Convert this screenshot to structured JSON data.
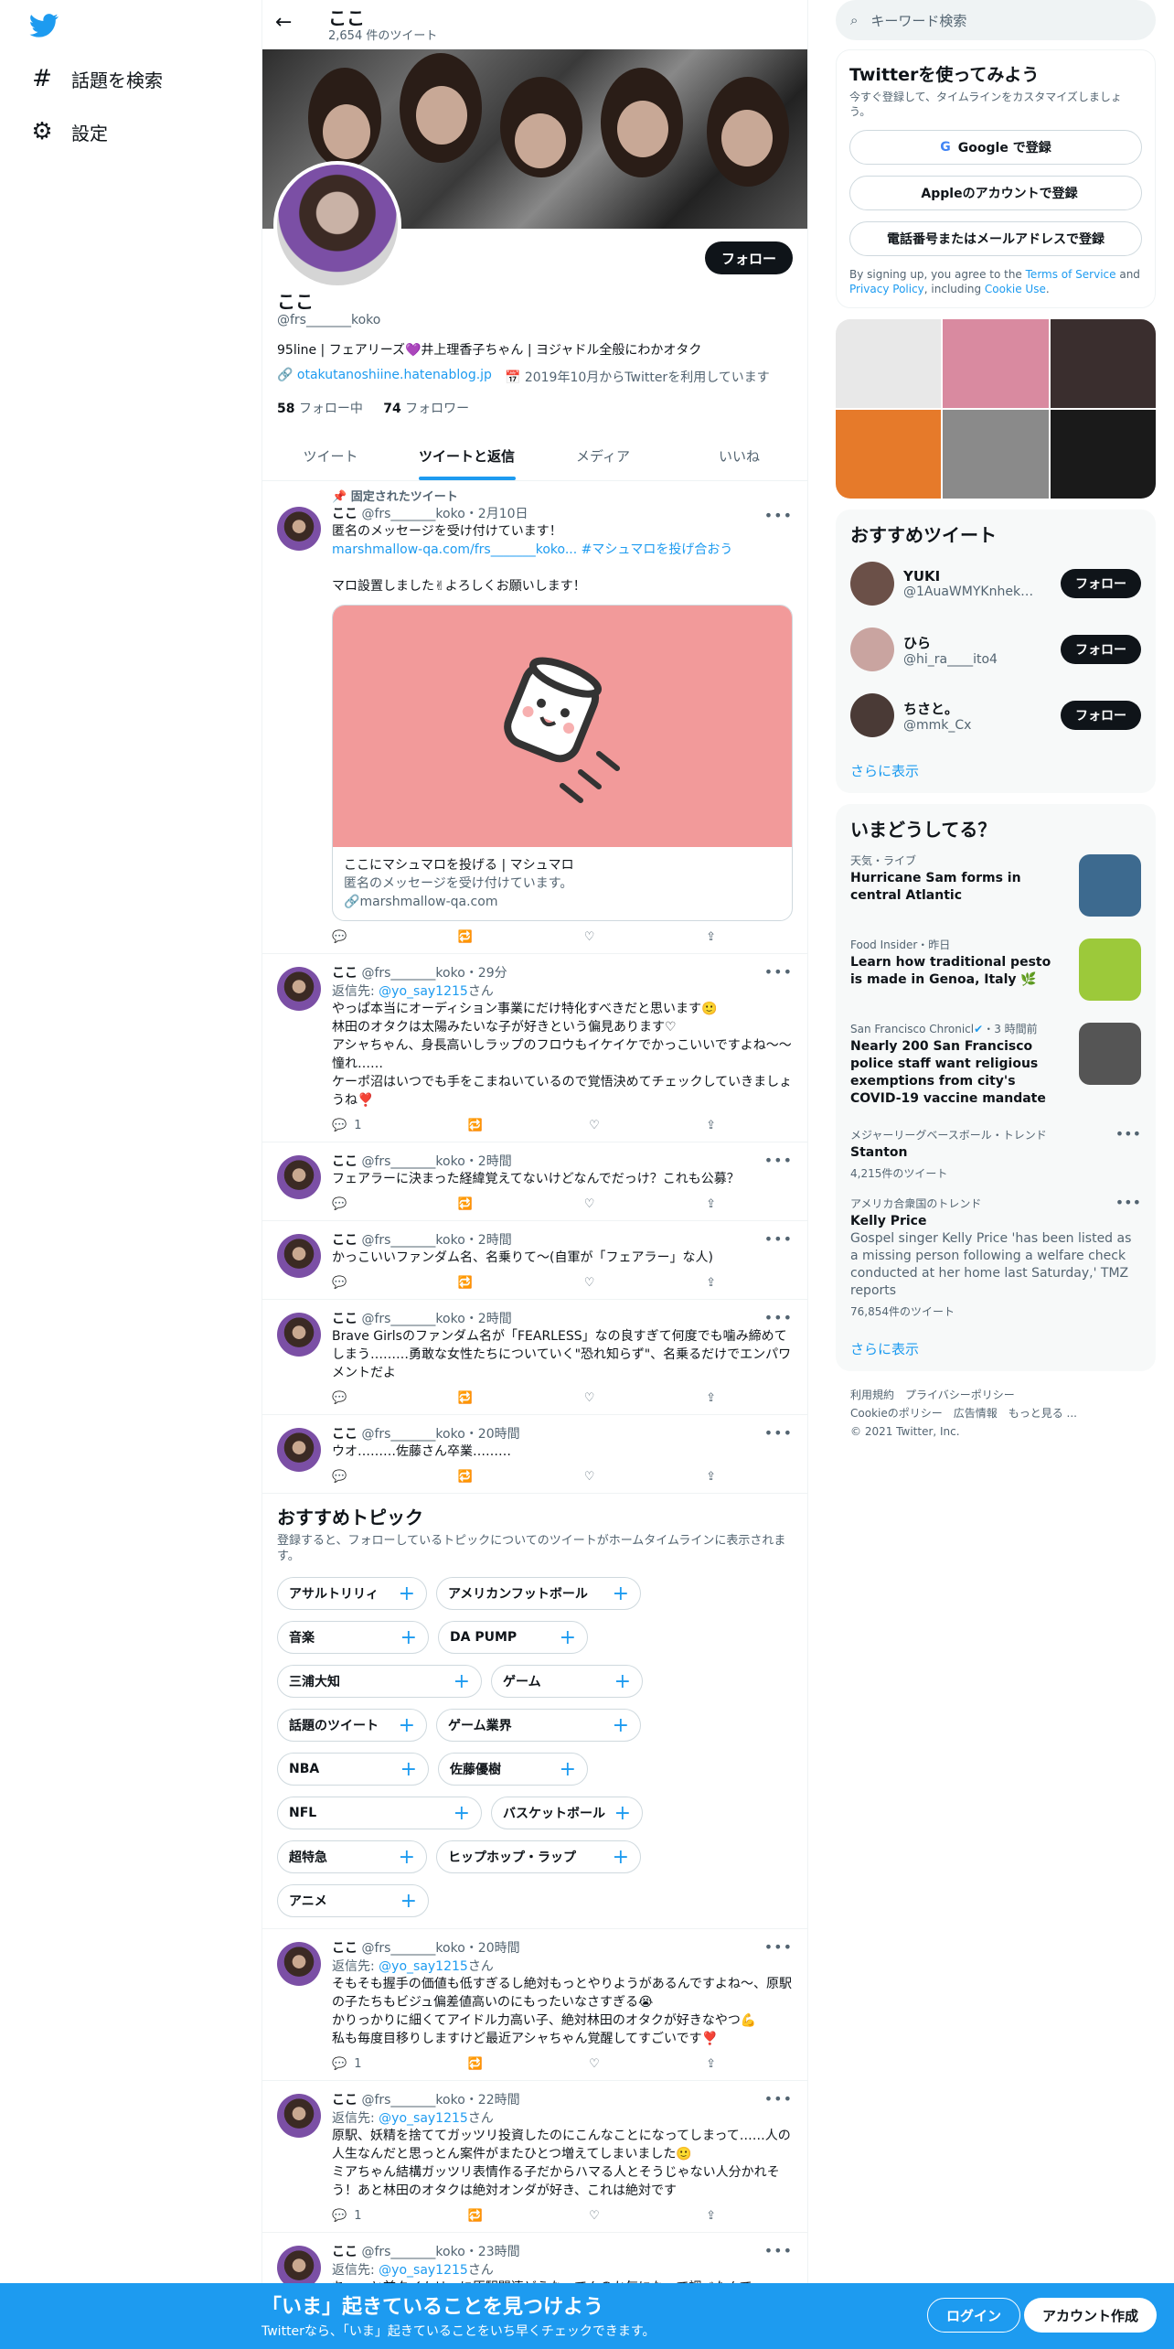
{
  "nav": {
    "explore": "話題を検索",
    "settings": "設定"
  },
  "header": {
    "name": "ここ",
    "count": "2,654 件のツイート"
  },
  "profile": {
    "follow": "フォロー",
    "name": "ここ",
    "handle": "@frs_______koko",
    "bio": "95line | フェアリーズ💜井上理香子ちゃん | ヨジャドル全般にわかオタク",
    "link": "otakutanoshiine.hatenablog.jp",
    "joined": "2019年10月からTwitterを利用しています",
    "following_count": "58",
    "following_label": "フォロー中",
    "followers_count": "74",
    "followers_label": "フォロワー"
  },
  "tabs": [
    "ツイート",
    "ツイートと返信",
    "メディア",
    "いいね"
  ],
  "pinned_label": "固定されたツイート",
  "tweets": [
    {
      "name": "ここ",
      "handle": "@frs_______koko",
      "time": "・2月10日",
      "text": "匿名のメッセージを受け付けています！",
      "link": "marshmallow-qa.com/frs_______koko...",
      "hashtag": "#マシュマロを投げ合おう",
      "text2": "マロ設置しました✌よろしくお願いします！",
      "card_title": "ここにマシュマロを投げる | マシュマロ",
      "card_sub": "匿名のメッセージを受け付けています。",
      "card_link": "marshmallow-qa.com"
    },
    {
      "name": "ここ",
      "handle": "@frs_______koko",
      "time": "・29分",
      "reply_prefix": "返信先: ",
      "reply_to": "@yo_say1215",
      "reply_suffix": "さん",
      "text": "やっぱ本当にオーディション事業にだけ特化すべきだと思います🙂\n林田のオタクは太陽みたいな子が好きという偏見あります♡\nアシャちゃん、身長高いしラップのフロウもイケイケでかっこいいですよね〜〜憧れ……\nケーポ沼はいつでも手をこまねいているので覚悟決めてチェックしていきましょうね❣️",
      "reply_count": "1"
    },
    {
      "name": "ここ",
      "handle": "@frs_______koko",
      "time": "・2時間",
      "text": "フェアラーに決まった経緯覚えてないけどなんでだっけ？これも公募？"
    },
    {
      "name": "ここ",
      "handle": "@frs_______koko",
      "time": "・2時間",
      "text": "かっこいいファンダム名、名乗りて〜(自軍が「フェアラー」な人)"
    },
    {
      "name": "ここ",
      "handle": "@frs_______koko",
      "time": "・2時間",
      "text": "Brave Girlsのファンダム名が「FEARLESS」なの良すぎて何度でも噛み締めてしまう………勇敢な女性たちについていく\"恐れ知らず\"、名乗るだけでエンパワメントだよ"
    },
    {
      "name": "ここ",
      "handle": "@frs_______koko",
      "time": "・20時間",
      "text": "ウオ………佐藤さん卒業………"
    },
    {
      "name": "ここ",
      "handle": "@frs_______koko",
      "time": "・20時間",
      "reply_prefix": "返信先: ",
      "reply_to": "@yo_say1215",
      "reply_suffix": "さん",
      "text": "そもそも握手の価値も低すぎるし絶対もっとやりようがあるんですよね〜、原駅の子たちもビジュ偏差値高いのにもったいなさすぎる😭\nかりっかりに細くてアイドル力高い子、絶対林田のオタクが好きなやつ💪\n私も毎度目移りしますけど最近アシャちゃん覚醒してすごいです❣️",
      "reply_count": "1"
    },
    {
      "name": "ここ",
      "handle": "@frs_______koko",
      "time": "・22時間",
      "reply_prefix": "返信先: ",
      "reply_to": "@yo_say1215",
      "reply_suffix": "さん",
      "text": "原駅、妖精を捨ててガッツリ投資したのにこんなことになってしまって……人の人生なんだと思っとん案件がまたひとつ増えてしまいました🙂\nミアちゃん結構ガッツリ表情作る子だからハマる人とそうじゃない人分かれそう！あと林田のオタクは絶対オンダが好き、これは絶対です",
      "reply_count": "1"
    },
    {
      "name": "ここ",
      "handle": "@frs_______koko",
      "time": "・23時間",
      "reply_prefix": "返信先: ",
      "reply_to": "@yo_say1215",
      "reply_suffix": "さん",
      "text": "ちょっと前タイムリーに原駅関連どうなってんのか気になって調べたんで"
    }
  ],
  "topics": {
    "title": "おすすめトピック",
    "desc": "登録すると、フォローしているトピックについてのツイートがホームタイムラインに表示されます。",
    "items": [
      "アサルトリリィ",
      "アメリカンフットボール",
      "音楽",
      "DA PUMP",
      "三浦大知",
      "ゲーム",
      "話題のツイート",
      "ゲーム業界",
      "NBA",
      "佐藤優樹",
      "NFL",
      "バスケットボール",
      "超特急",
      "ヒップホップ・ラップ",
      "アニメ"
    ]
  },
  "sidebar": {
    "search_placeholder": "キーワード検索",
    "signup": {
      "title": "Twitterを使ってみよう",
      "desc": "今すぐ登録して、タイムラインをカスタマイズしましょう。",
      "google": "Google で登録",
      "apple": "Appleのアカウントで登録",
      "phone": "電話番号またはメールアドレスで登録",
      "terms_a": "By signing up, you agree to the ",
      "terms_tos": "Terms of Service",
      "terms_b": " and ",
      "terms_privacy": "Privacy Policy",
      "terms_c": ", including ",
      "terms_cookie": "Cookie Use",
      "terms_d": "."
    },
    "who": {
      "title": "おすすめツイート",
      "users": [
        {
          "name": "YUKI",
          "handle": "@1AuaWMYKnhekB..."
        },
        {
          "name": "ひら",
          "handle": "@hi_ra____ito4"
        },
        {
          "name": "ちさと。",
          "handle": "@mmk_Cx"
        }
      ],
      "follow": "フォロー",
      "more": "さらに表示"
    },
    "trends": {
      "title": "いまどうしてる？",
      "items": [
        {
          "ctx": "天気・ライブ",
          "title": "Hurricane Sam forms in central Atlantic"
        },
        {
          "ctx": "Food Insider",
          "time": "・昨日",
          "title": "Learn how traditional pesto is made in Genoa, Italy 🌿"
        },
        {
          "ctx": "San Francisco Chronicl",
          "time": "・3 時間前",
          "title": "Nearly 200 San Francisco police staff want religious exemptions from city's COVID-19 vaccine mandate"
        },
        {
          "ctx": "メジャーリーグベースボール・トレンド",
          "title": "Stanton",
          "count": "4,215件のツイート"
        },
        {
          "ctx": "アメリカ合衆国のトレンド",
          "title": "Kelly Price",
          "desc": "Gospel singer Kelly Price 'has been listed as a missing person following a welfare check conducted at her home last Saturday,' TMZ reports",
          "count": "76,854件のツイート"
        }
      ],
      "more": "さらに表示"
    },
    "footer": {
      "l1": "利用規約　プライバシーポリシー",
      "l2": "Cookieのポリシー　広告情報　もっと見る ...",
      "l3": "© 2021 Twitter, Inc."
    }
  },
  "bottom": {
    "title": "「いま」起きていることを見つけよう",
    "sub": "Twitterなら、「いま」起きていることをいち早くチェックできます。",
    "login": "ログイン",
    "signup": "アカウント作成"
  }
}
